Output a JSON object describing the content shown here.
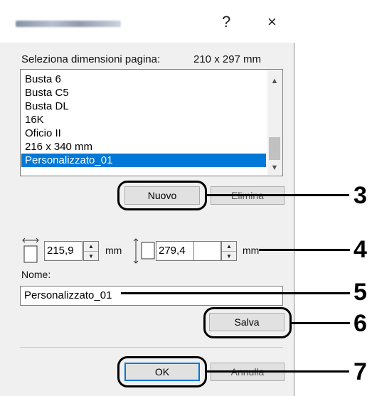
{
  "dialog": {
    "title_buttons": {
      "help": "?",
      "close": "×"
    }
  },
  "page_size": {
    "label": "Seleziona dimensioni pagina:",
    "current_value": "210 x 297 mm",
    "list_items": [
      "Busta 6",
      "Busta C5",
      "Busta DL",
      "16K",
      "Oficio II",
      "216 x 340 mm",
      "Personalizzato_01"
    ],
    "selected_index": 6
  },
  "buttons": {
    "new_label": "Nuovo",
    "delete_label": "Elimina",
    "save_label": "Salva",
    "ok_label": "OK",
    "cancel_label": "Annulla"
  },
  "dimensions": {
    "width_value": "215,9",
    "width_unit": "mm",
    "height_value": "279,4",
    "height_unit": "mm"
  },
  "name_field": {
    "label": "Nome:",
    "value": "Personalizzato_01"
  },
  "callouts": [
    "3",
    "4",
    "5",
    "6",
    "7"
  ],
  "colors": {
    "selection": "#0078d7",
    "dialog_bg": "#f0f0f0"
  }
}
